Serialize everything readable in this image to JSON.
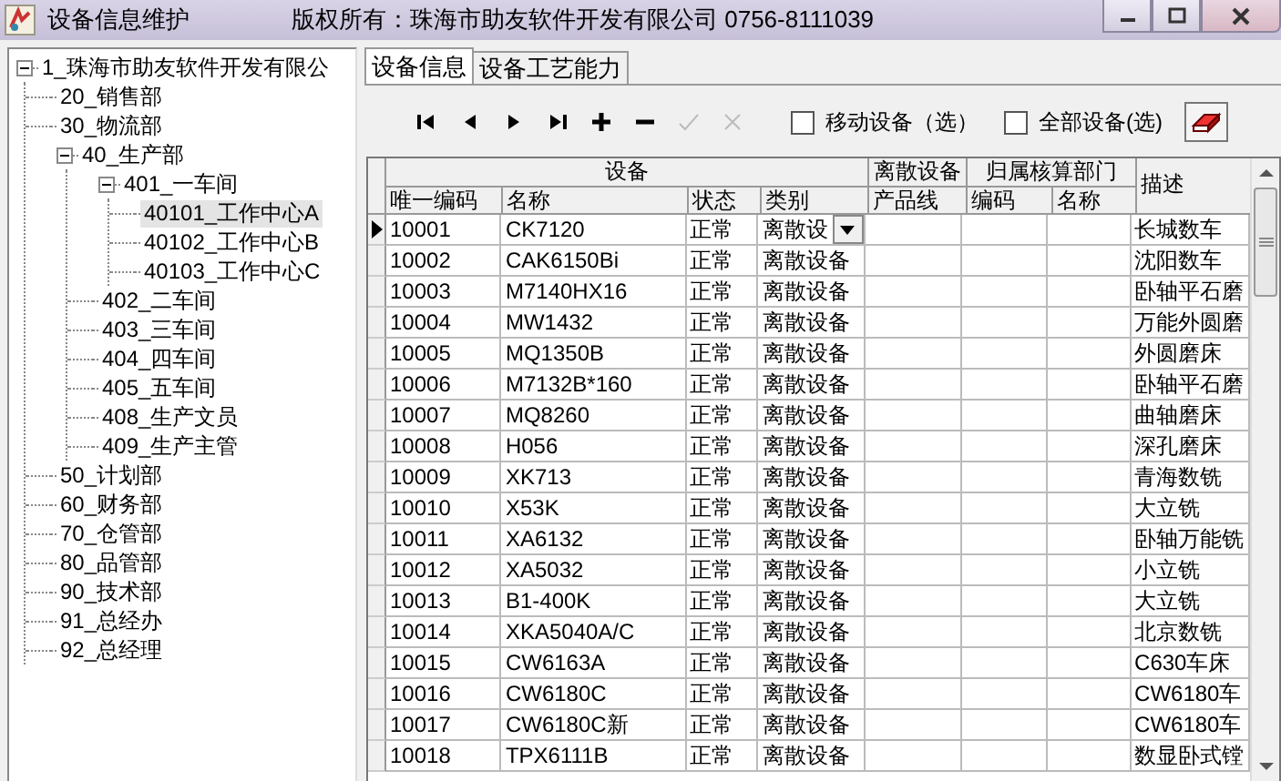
{
  "window": {
    "title": "设备信息维护",
    "copyright": "版权所有：珠海市助友软件开发有限公司 0756-8111039"
  },
  "tree": [
    {
      "label": "1_珠海市助友软件开发有限公",
      "expanded": true,
      "selected": false,
      "children": [
        {
          "label": "20_销售部",
          "selected": false
        },
        {
          "label": "30_物流部",
          "selected": false
        },
        {
          "label": "40_生产部",
          "expanded": true,
          "selected": false,
          "children": [
            {
              "label": "401_一车间",
              "expanded": true,
              "selected": false,
              "children": [
                {
                  "label": "40101_工作中心A",
                  "selected": true
                },
                {
                  "label": "40102_工作中心B",
                  "selected": false
                },
                {
                  "label": "40103_工作中心C",
                  "selected": false
                }
              ]
            },
            {
              "label": "402_二车间",
              "selected": false
            },
            {
              "label": "403_三车间",
              "selected": false
            },
            {
              "label": "404_四车间",
              "selected": false
            },
            {
              "label": "405_五车间",
              "selected": false
            },
            {
              "label": "408_生产文员",
              "selected": false
            },
            {
              "label": "409_生产主管",
              "selected": false
            }
          ]
        },
        {
          "label": "50_计划部",
          "selected": false
        },
        {
          "label": "60_财务部",
          "selected": false
        },
        {
          "label": "70_仓管部",
          "selected": false
        },
        {
          "label": "80_品管部",
          "selected": false
        },
        {
          "label": "90_技术部",
          "selected": false
        },
        {
          "label": "91_总经办",
          "selected": false
        },
        {
          "label": "92_总经理",
          "selected": false
        }
      ]
    }
  ],
  "tabs": [
    {
      "label": "设备信息",
      "selected": true
    },
    {
      "label": "设备工艺能力",
      "selected": false
    }
  ],
  "toolbar": [
    {
      "kind": "first",
      "disabled": false
    },
    {
      "kind": "prev",
      "disabled": false
    },
    {
      "kind": "next",
      "disabled": false
    },
    {
      "kind": "last",
      "disabled": false
    },
    {
      "kind": "add",
      "disabled": false
    },
    {
      "kind": "delete",
      "disabled": false
    },
    {
      "kind": "post",
      "disabled": true
    },
    {
      "kind": "cancel",
      "disabled": true
    }
  ],
  "checkboxes": [
    {
      "label": "移动设备（选）",
      "checked": false
    },
    {
      "label": "全部设备(选)",
      "checked": false
    }
  ],
  "table": {
    "groups": [
      {
        "label": "设备"
      },
      {
        "label": "离散设备"
      },
      {
        "label": "归属核算部门"
      }
    ],
    "columns": [
      "唯一编码",
      "名称",
      "状态",
      "类别",
      "产品线",
      "编码",
      "名称",
      "描述"
    ],
    "rows": [
      {
        "current": true,
        "cells": [
          "10001",
          "CK7120",
          "正常",
          "离散设",
          "",
          "",
          "",
          "长城数车"
        ]
      },
      {
        "current": false,
        "cells": [
          "10002",
          "CAK6150Bi",
          "正常",
          "离散设备",
          "",
          "",
          "",
          "沈阳数车"
        ]
      },
      {
        "current": false,
        "cells": [
          "10003",
          "M7140HX16",
          "正常",
          "离散设备",
          "",
          "",
          "",
          "卧轴平石磨"
        ]
      },
      {
        "current": false,
        "cells": [
          "10004",
          "MW1432",
          "正常",
          "离散设备",
          "",
          "",
          "",
          "万能外圆磨"
        ]
      },
      {
        "current": false,
        "cells": [
          "10005",
          "MQ1350B",
          "正常",
          "离散设备",
          "",
          "",
          "",
          "外圆磨床"
        ]
      },
      {
        "current": false,
        "cells": [
          "10006",
          "M7132B*160",
          "正常",
          "离散设备",
          "",
          "",
          "",
          "卧轴平石磨"
        ]
      },
      {
        "current": false,
        "cells": [
          "10007",
          "MQ8260",
          "正常",
          "离散设备",
          "",
          "",
          "",
          "曲轴磨床"
        ]
      },
      {
        "current": false,
        "cells": [
          "10008",
          "H056",
          "正常",
          "离散设备",
          "",
          "",
          "",
          "深孔磨床"
        ]
      },
      {
        "current": false,
        "cells": [
          "10009",
          "XK713",
          "正常",
          "离散设备",
          "",
          "",
          "",
          "青海数铣"
        ]
      },
      {
        "current": false,
        "cells": [
          "10010",
          "X53K",
          "正常",
          "离散设备",
          "",
          "",
          "",
          "大立铣"
        ]
      },
      {
        "current": false,
        "cells": [
          "10011",
          "XA6132",
          "正常",
          "离散设备",
          "",
          "",
          "",
          "卧轴万能铣"
        ]
      },
      {
        "current": false,
        "cells": [
          "10012",
          "XA5032",
          "正常",
          "离散设备",
          "",
          "",
          "",
          "小立铣"
        ]
      },
      {
        "current": false,
        "cells": [
          "10013",
          "B1-400K",
          "正常",
          "离散设备",
          "",
          "",
          "",
          "大立铣"
        ]
      },
      {
        "current": false,
        "cells": [
          "10014",
          "XKA5040A/C",
          "正常",
          "离散设备",
          "",
          "",
          "",
          "北京数铣"
        ]
      },
      {
        "current": false,
        "cells": [
          "10015",
          "CW6163A",
          "正常",
          "离散设备",
          "",
          "",
          "",
          "C630车床"
        ]
      },
      {
        "current": false,
        "cells": [
          "10016",
          "CW6180C",
          "正常",
          "离散设备",
          "",
          "",
          "",
          "CW6180车"
        ]
      },
      {
        "current": false,
        "cells": [
          "10017",
          "CW6180C新",
          "正常",
          "离散设备",
          "",
          "",
          "",
          "CW6180车"
        ]
      },
      {
        "current": false,
        "cells": [
          "10018",
          "TPX6111B",
          "正常",
          "离散设备",
          "",
          "",
          "",
          "数显卧式镗"
        ]
      }
    ]
  }
}
